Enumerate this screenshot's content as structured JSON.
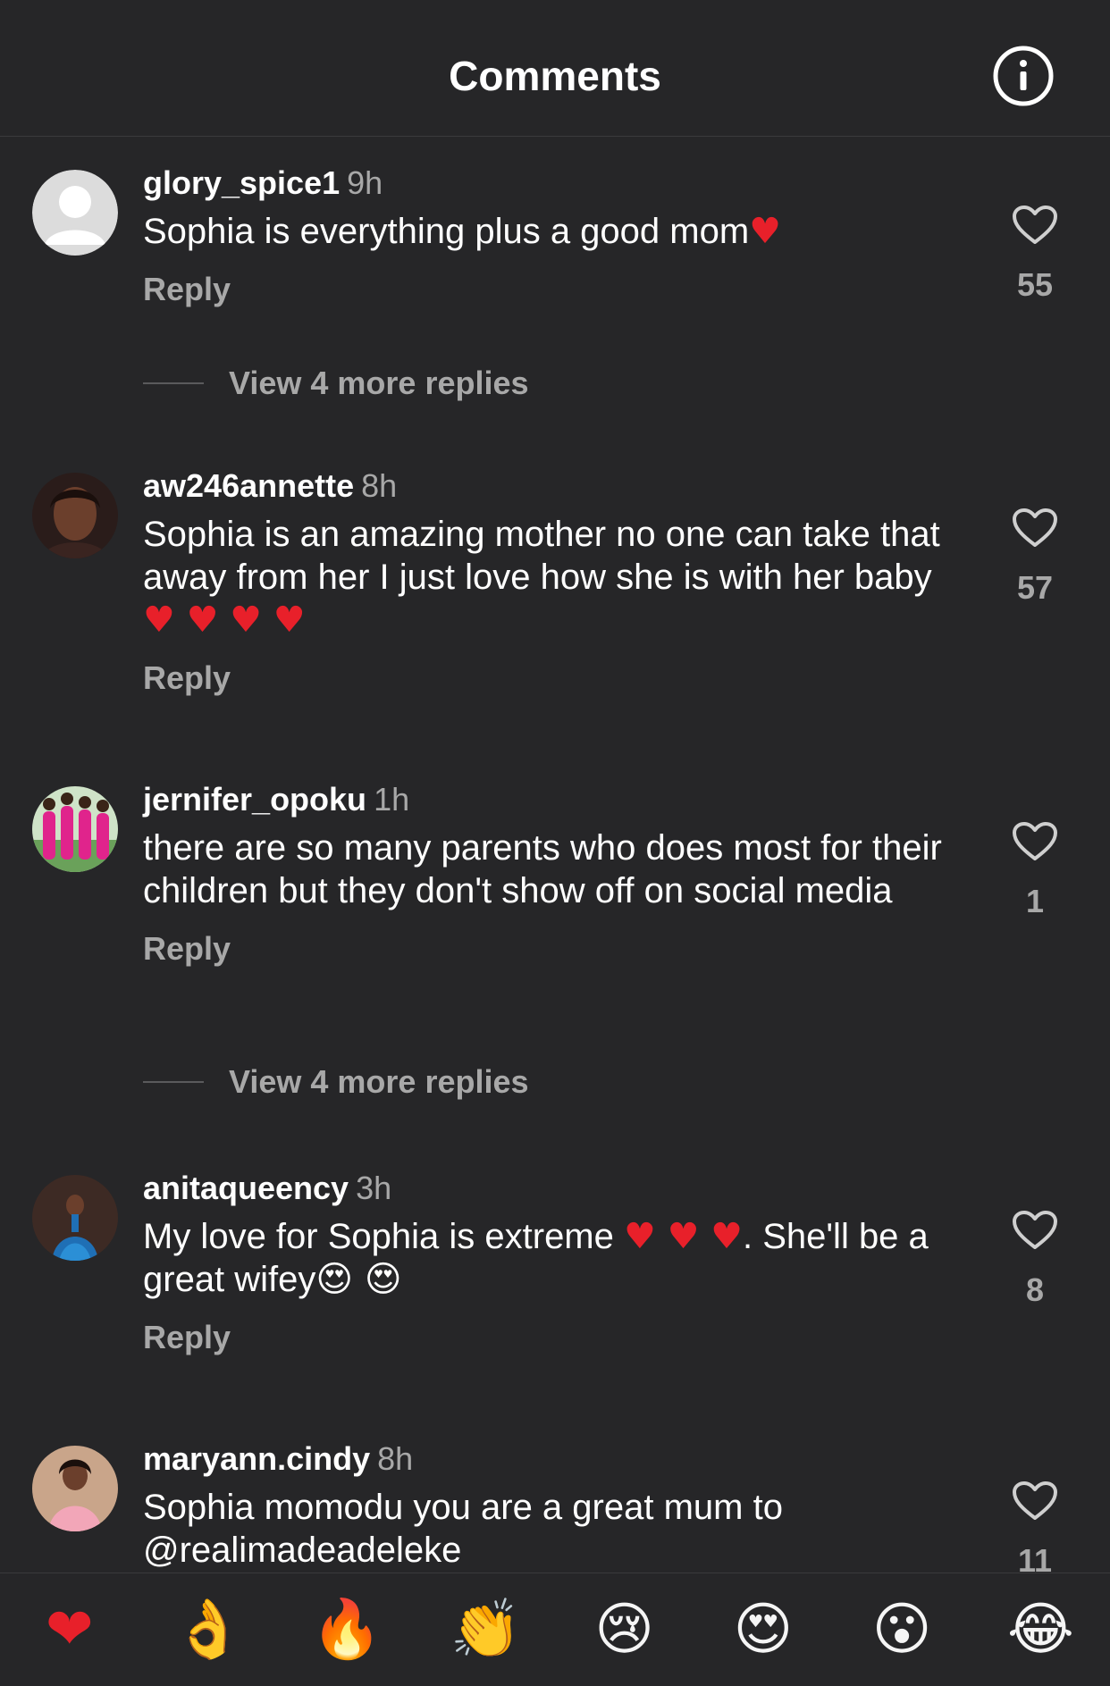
{
  "header": {
    "title": "Comments",
    "info_icon": "info-icon"
  },
  "comments": [
    {
      "username": "glory_spice1",
      "time": "9h",
      "text": "Sophia is everything plus a good mom",
      "emoji": "♥",
      "likes": "55",
      "reply_label": "Reply",
      "view_more": "View 4 more replies",
      "avatar": "default-avatar"
    },
    {
      "username": "aw246annette",
      "time": "8h",
      "text": "Sophia is an amazing mother no one can take that away from her I just love how she is with her baby",
      "emoji": "♥ ♥ ♥ ♥",
      "likes": "57",
      "reply_label": "Reply",
      "avatar": "photo-avatar"
    },
    {
      "username": "jernifer_opoku",
      "time": "1h",
      "text": "there are so many parents who does most for their children but they don't show off on social media",
      "likes": "1",
      "reply_label": "Reply",
      "view_more": "View 4 more replies",
      "avatar": "photo-avatar"
    },
    {
      "username": "anitaqueency",
      "time": "3h",
      "text_part1": "My love for Sophia is extreme",
      "emoji_hearts": "♥ ♥ ♥",
      "text_part2": ". She'll be a great wifey",
      "emoji_faces": "😍 😍",
      "likes": "8",
      "reply_label": "Reply",
      "avatar": "photo-avatar"
    },
    {
      "username": "maryann.cindy",
      "time": "8h",
      "text": "Sophia momodu you are a great mum to @realimadeadeleke",
      "likes": "11",
      "avatar": "photo-avatar"
    }
  ],
  "emoji_bar": [
    {
      "name": "red-heart-emoji",
      "glyph": "❤"
    },
    {
      "name": "ok-hand-emoji",
      "glyph": "👌"
    },
    {
      "name": "fire-emoji",
      "glyph": "🔥"
    },
    {
      "name": "clapping-hands-emoji",
      "glyph": "👏"
    },
    {
      "name": "crying-face-emoji",
      "glyph": "😢"
    },
    {
      "name": "heart-eyes-emoji",
      "glyph": "😍"
    },
    {
      "name": "surprised-face-emoji",
      "glyph": "😮"
    },
    {
      "name": "tears-of-joy-emoji",
      "glyph": "😂"
    }
  ],
  "colors": {
    "background": "#262628",
    "secondary_text": "#a8a8a8",
    "heart_red": "#e8202a"
  }
}
